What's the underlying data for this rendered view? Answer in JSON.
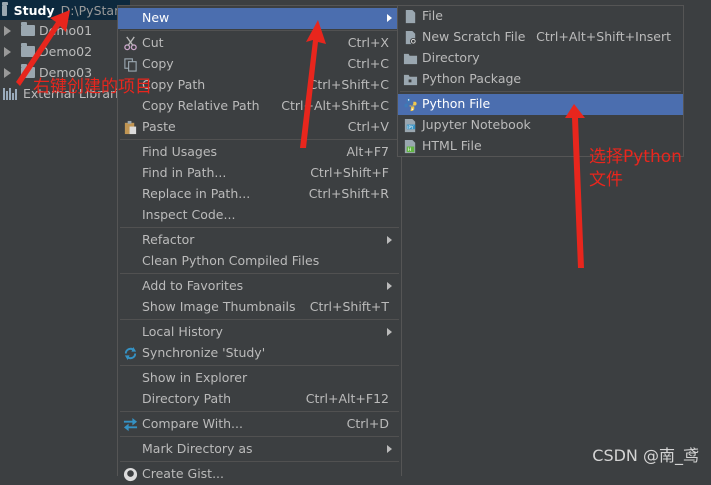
{
  "project": {
    "name": "Study",
    "path": "D:\\PyStar...",
    "items": [
      {
        "label": "Demo01"
      },
      {
        "label": "Demo02"
      },
      {
        "label": "Demo03"
      }
    ],
    "libraries": "External Libraries"
  },
  "context_menu": {
    "items": [
      {
        "label": "New",
        "shortcut": "",
        "submenu": true,
        "highlighted": true
      },
      {
        "label": "Cut",
        "shortcut": "Ctrl+X",
        "icon": "scissors-icon"
      },
      {
        "label": "Copy",
        "shortcut": "Ctrl+C",
        "icon": "copy-icon"
      },
      {
        "label": "Copy Path",
        "shortcut": "Ctrl+Shift+C"
      },
      {
        "label": "Copy Relative Path",
        "shortcut": "Ctrl+Alt+Shift+C"
      },
      {
        "label": "Paste",
        "shortcut": "Ctrl+V",
        "icon": "paste-icon"
      },
      {
        "label": "Find Usages",
        "shortcut": "Alt+F7"
      },
      {
        "label": "Find in Path...",
        "shortcut": "Ctrl+Shift+F"
      },
      {
        "label": "Replace in Path...",
        "shortcut": "Ctrl+Shift+R"
      },
      {
        "label": "Inspect Code..."
      },
      {
        "label": "Refactor",
        "submenu": true
      },
      {
        "label": "Clean Python Compiled Files"
      },
      {
        "label": "Add to Favorites",
        "submenu": true
      },
      {
        "label": "Show Image Thumbnails",
        "shortcut": "Ctrl+Shift+T"
      },
      {
        "label": "Local History",
        "submenu": true
      },
      {
        "label": "Synchronize 'Study'",
        "icon": "sync-icon"
      },
      {
        "label": "Show in Explorer"
      },
      {
        "label": "Directory Path",
        "shortcut": "Ctrl+Alt+F12"
      },
      {
        "label": "Compare With...",
        "shortcut": "Ctrl+D",
        "icon": "compare-icon"
      },
      {
        "label": "Mark Directory as",
        "submenu": true
      },
      {
        "label": "Create Gist...",
        "icon": "github-icon"
      }
    ]
  },
  "new_submenu": {
    "items": [
      {
        "label": "File",
        "icon": "file-icon"
      },
      {
        "label": "New Scratch File",
        "shortcut": "Ctrl+Alt+Shift+Insert",
        "icon": "scratch-file-icon"
      },
      {
        "label": "Directory",
        "icon": "directory-icon"
      },
      {
        "label": "Python Package",
        "icon": "python-package-icon"
      },
      {
        "label": "Python File",
        "icon": "python-file-icon",
        "highlighted": true
      },
      {
        "label": "Jupyter Notebook",
        "icon": "jupyter-icon"
      },
      {
        "label": "HTML File",
        "icon": "html-file-icon"
      }
    ]
  },
  "annotations": {
    "create_project": "右键创建的项目",
    "select_python_line1": "选择Python",
    "select_python_line2": "文件"
  },
  "watermark": "CSDN @南_鸢",
  "colors": {
    "background": "#3c3f41",
    "highlight": "#4b6eaf",
    "annotation": "#e8261d",
    "project_header": "#0d293e"
  }
}
